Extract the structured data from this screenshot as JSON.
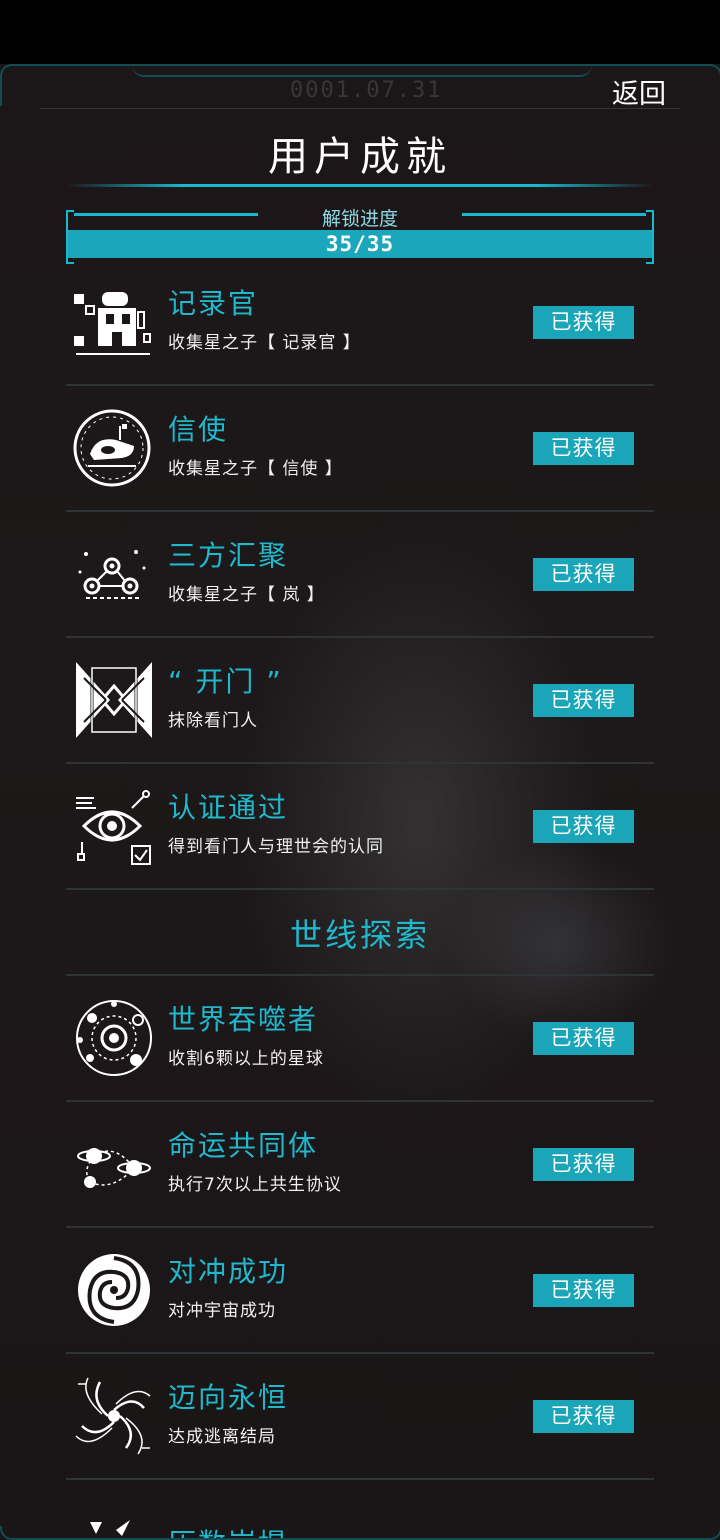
{
  "header": {
    "ghost_time": "0001.07.31",
    "back_label": "返回",
    "title": "用户成就"
  },
  "progress": {
    "label": "解锁进度",
    "text": "35/35",
    "fraction": 1.0
  },
  "achievements": [
    {
      "name": "记录官",
      "desc": "收集星之子【 记录官 】",
      "badge": "已获得",
      "icon": "robot-archivist-icon"
    },
    {
      "name": "信使",
      "desc": "收集星之子【 信使 】",
      "badge": "已获得",
      "icon": "messenger-ship-icon"
    },
    {
      "name": "三方汇聚",
      "desc": "收集星之子【 岚 】",
      "badge": "已获得",
      "icon": "network-nodes-icon"
    },
    {
      "name": "“ 开门 ”",
      "desc": "抹除看门人",
      "badge": "已获得",
      "icon": "gate-icon"
    },
    {
      "name": "认证通过",
      "desc": "得到看门人与理世会的认同",
      "badge": "已获得",
      "icon": "eye-scan-icon"
    }
  ],
  "section": {
    "title": "世线探索"
  },
  "explore": [
    {
      "name": "世界吞噬者",
      "desc": "收割6颗以上的星球",
      "badge": "已获得",
      "icon": "planet-orbits-icon"
    },
    {
      "name": "命运共同体",
      "desc": "执行7次以上共生协议",
      "badge": "已获得",
      "icon": "linked-planets-icon"
    },
    {
      "name": "对冲成功",
      "desc": "对冲宇宙成功",
      "badge": "已获得",
      "icon": "vortex-icon"
    },
    {
      "name": "迈向永恒",
      "desc": "达成逃离结局",
      "badge": "已获得",
      "icon": "spiral-galaxy-icon"
    }
  ],
  "cut_item": {
    "name": "历数崩塌"
  },
  "colors": {
    "accent": "#1fb8cc",
    "badge": "#1aa6b8",
    "background": "#1b1617"
  }
}
